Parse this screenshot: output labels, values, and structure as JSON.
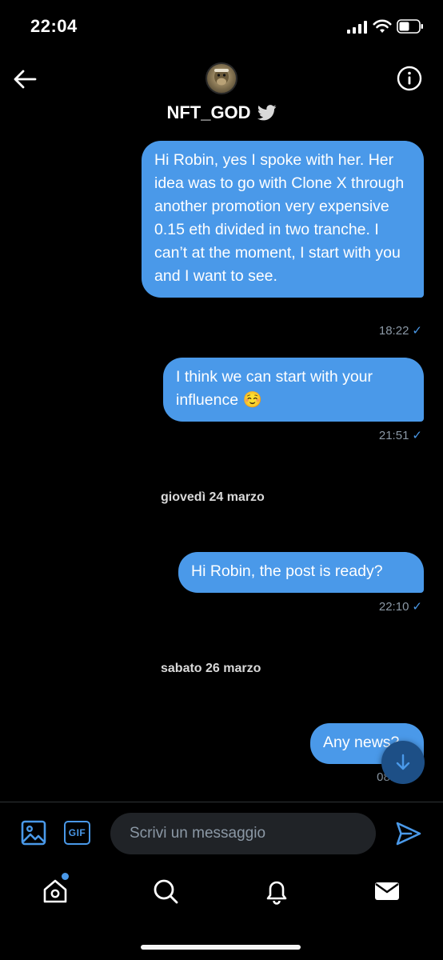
{
  "status_bar": {
    "time": "22:04"
  },
  "header": {
    "contact_name": "NFT_GOD"
  },
  "messages": [
    {
      "text": "Hi Robin, yes I spoke with her. Her idea was to go with Clone X through another promotion very expensive 0.15 eth divided in two tranche. I can’t at the moment, I start with you and I want to see.",
      "time": "18:22"
    },
    {
      "text": "I think we can start with your influence ☺️",
      "time": "21:51"
    },
    {
      "text": "Hi Robin, the post is ready?",
      "time": "22:10"
    },
    {
      "text": "Any news?",
      "time": "08:"
    }
  ],
  "date_separators": [
    "giovedì 24 marzo",
    "sabato 26 marzo"
  ],
  "composer": {
    "placeholder": "Scrivi un messaggio",
    "gif_label": "GIF"
  },
  "tabs": [
    "home",
    "search",
    "notifications",
    "messages"
  ],
  "colors": {
    "accent": "#4a99e9",
    "background": "#000000",
    "muted": "#8b98a5"
  }
}
